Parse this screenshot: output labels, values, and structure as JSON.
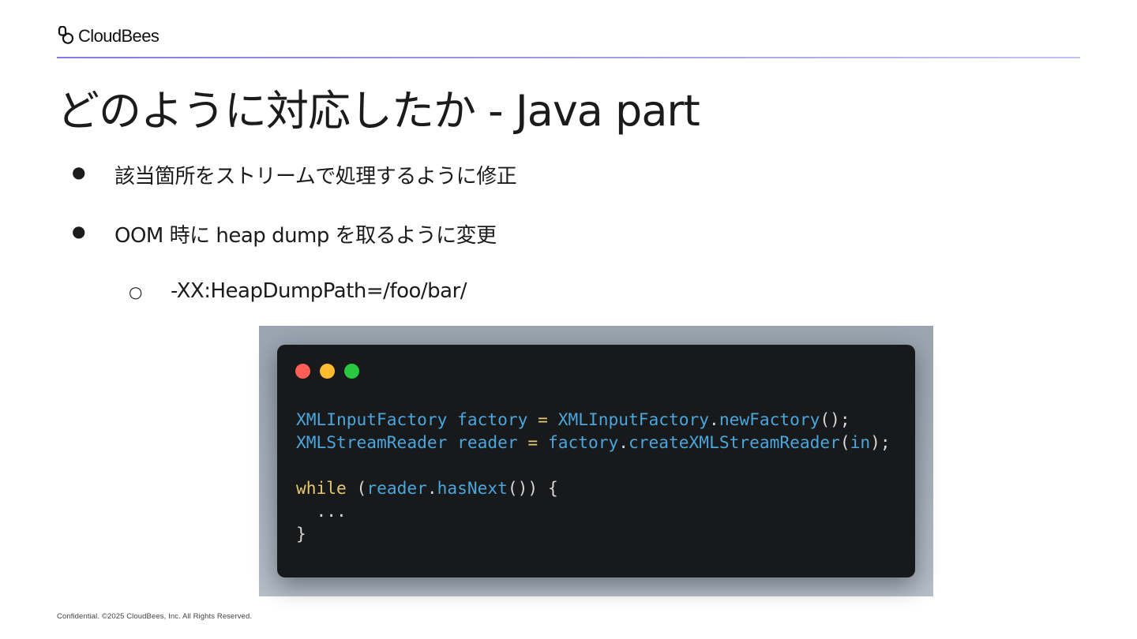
{
  "header": {
    "logo_icon": "cloudbees-logo-icon",
    "logo_text": "CloudBees",
    "rule_colors": [
      "#7f7ce4",
      "#c2c1f4"
    ]
  },
  "slide": {
    "title": "どのように対応したか - Java part",
    "bullets": [
      {
        "marker": "●",
        "text": "該当箇所をストリームで処理するように修正"
      },
      {
        "marker": "●",
        "text": "OOM 時に heap dump を取るように変更"
      }
    ],
    "sub_bullets": [
      {
        "marker": "○",
        "text": "-XX:HeapDumpPath=/foo/bar/"
      }
    ]
  },
  "code_snippet": {
    "window_lights": [
      "#ff5f57",
      "#febc2e",
      "#28c840"
    ],
    "line1": {
      "type": "XMLInputFactory",
      "var": "factory",
      "eq": "=",
      "cls": "XMLInputFactory",
      "dot": ".",
      "method": "newFactory",
      "tail": "();"
    },
    "line2": {
      "type": "XMLStreamReader",
      "var": "reader",
      "eq": "=",
      "obj": "factory",
      "dot": ".",
      "method": "createXMLStreamReader",
      "open": "(",
      "arg": "in",
      "tail": ");"
    },
    "line4": {
      "kw": "while",
      "open": "(",
      "obj": "reader",
      "dot": ".",
      "method": "hasNext",
      "tail": "()) {"
    },
    "line5": "  ...",
    "line6": "}"
  },
  "footer": {
    "text": "Confidential. ©2025 CloudBees, Inc. All Rights Reserved."
  }
}
